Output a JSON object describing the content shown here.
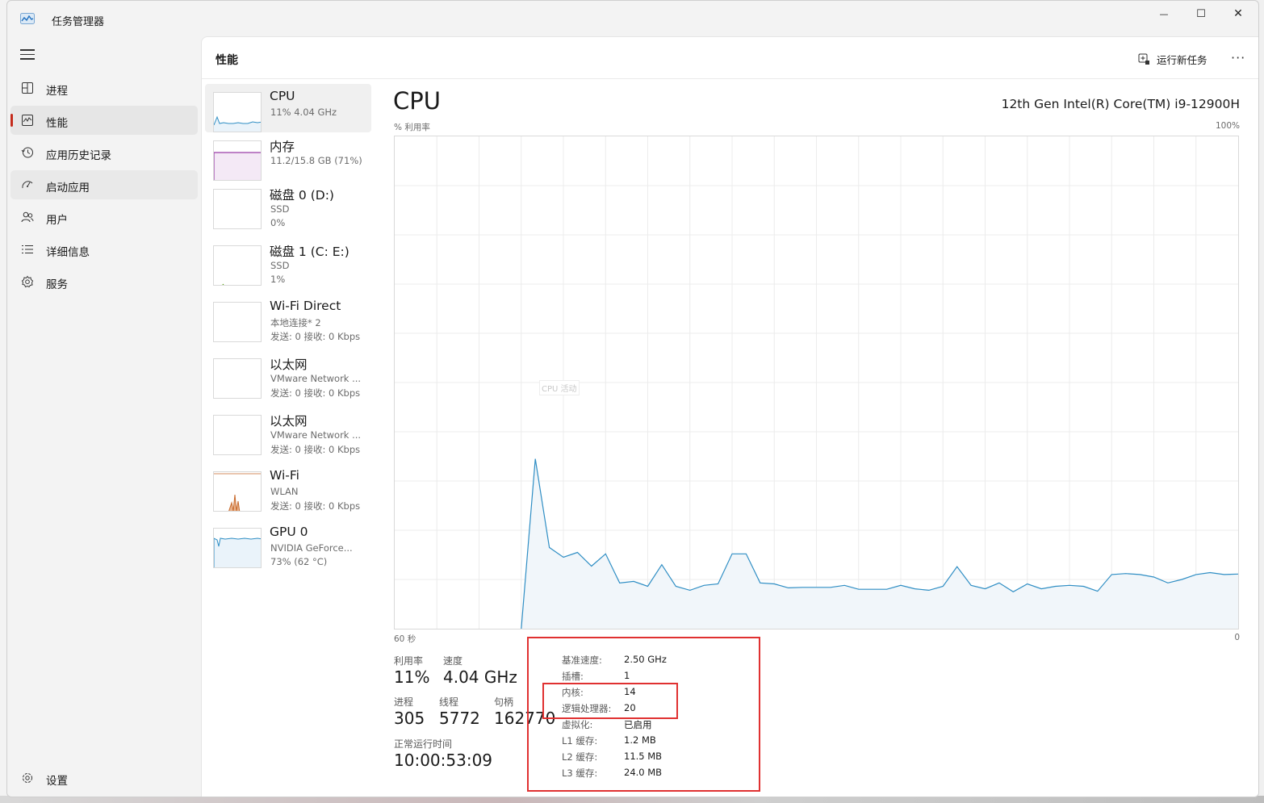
{
  "app": {
    "title": "任务管理器"
  },
  "window_controls": {
    "minimize": "—",
    "maximize": "☐",
    "close": "✕"
  },
  "sidebar": {
    "items": [
      {
        "label": "进程",
        "icon": "processes-icon"
      },
      {
        "label": "性能",
        "icon": "performance-icon",
        "selected": true
      },
      {
        "label": "应用历史记录",
        "icon": "history-icon"
      },
      {
        "label": "启动应用",
        "icon": "startup-icon"
      },
      {
        "label": "用户",
        "icon": "users-icon"
      },
      {
        "label": "详细信息",
        "icon": "details-icon"
      },
      {
        "label": "服务",
        "icon": "services-icon"
      }
    ],
    "settings_label": "设置"
  },
  "header": {
    "title": "性能",
    "run_task": "运行新任务",
    "more": "···"
  },
  "devices": [
    {
      "name": "CPU",
      "line2": "11% 4.04 GHz",
      "line3": ""
    },
    {
      "name": "内存",
      "line2": "11.2/15.8 GB (71%)",
      "line3": ""
    },
    {
      "name": "磁盘 0 (D:)",
      "line2": "SSD",
      "line3": "0%"
    },
    {
      "name": "磁盘 1 (C: E:)",
      "line2": "SSD",
      "line3": "1%"
    },
    {
      "name": "Wi-Fi Direct",
      "line2": "本地连接* 2",
      "line3": "发送: 0 接收: 0 Kbps"
    },
    {
      "name": "以太网",
      "line2": "VMware Network ...",
      "line3": "发送: 0 接收: 0 Kbps"
    },
    {
      "name": "以太网",
      "line2": "VMware Network ...",
      "line3": "发送: 0 接收: 0 Kbps"
    },
    {
      "name": "Wi-Fi",
      "line2": "WLAN",
      "line3": "发送: 0 接收: 0 Kbps"
    },
    {
      "name": "GPU 0",
      "line2": "NVIDIA GeForce...",
      "line3": "73% (62 °C)"
    }
  ],
  "main": {
    "title": "CPU",
    "model": "12th Gen Intel(R) Core(TM) i9-12900H",
    "y_label": "% 利用率",
    "y_max_label": "100%",
    "x_left_label": "60 秒",
    "x_right_label": "0",
    "activity_label": "CPU 活动",
    "stats": {
      "util_label": "利用率",
      "util_value": "11%",
      "speed_label": "速度",
      "speed_value": "4.04 GHz",
      "proc_label": "进程",
      "proc_value": "305",
      "thread_label": "线程",
      "thread_value": "5772",
      "handle_label": "句柄",
      "handle_value": "162770",
      "uptime_label": "正常运行时间",
      "uptime_value": "10:00:53:09"
    },
    "specs": [
      {
        "key": "基准速度:",
        "value": "2.50 GHz"
      },
      {
        "key": "插槽:",
        "value": "1"
      },
      {
        "key": "内核:",
        "value": "14"
      },
      {
        "key": "逻辑处理器:",
        "value": "20"
      },
      {
        "key": "虚拟化:",
        "value": "已启用"
      },
      {
        "key": "L1 缓存:",
        "value": "1.2 MB"
      },
      {
        "key": "L2 缓存:",
        "value": "11.5 MB"
      },
      {
        "key": "L3 缓存:",
        "value": "24.0 MB"
      }
    ]
  },
  "chart_data": {
    "type": "area",
    "xlabel": "60 秒",
    "ylabel": "% 利用率",
    "ylim": [
      0,
      100
    ],
    "xlim": [
      60,
      0
    ],
    "grid": true,
    "series": [
      {
        "x": [
          51,
          50,
          49,
          48,
          47,
          46,
          45,
          44,
          43,
          42,
          41,
          40,
          39,
          38,
          37,
          36,
          35,
          34,
          33,
          32,
          31,
          30,
          29,
          28,
          27,
          26,
          25,
          24,
          23,
          22,
          21,
          20,
          19,
          18,
          17,
          16,
          15,
          14,
          13,
          12,
          11,
          10,
          9,
          8,
          7,
          6,
          5,
          4,
          3,
          2,
          1,
          0
        ],
        "values": [
          0,
          34.5,
          16.5,
          14.5,
          15.5,
          12.7,
          15.2,
          9.3,
          9.6,
          8.6,
          13,
          8.6,
          7.8,
          8.8,
          9.1,
          15.2,
          15.2,
          9.3,
          9.1,
          8.3,
          8.4,
          8.4,
          8.4,
          8.8,
          8,
          8,
          8,
          8.8,
          8.1,
          7.8,
          8.6,
          12.6,
          8.8,
          8.1,
          9.3,
          7.5,
          9.1,
          8.1,
          8.6,
          8.8,
          8.6,
          7.6,
          11,
          11.2,
          11,
          10.5,
          9.3,
          10,
          11,
          11.4,
          11,
          11.1
        ]
      }
    ]
  },
  "colors": {
    "accent_line": "#2f8ec4",
    "accent_fill": "#f1f6fa",
    "memory": "#9b3ea8",
    "wifi": "#c8692b",
    "highlight": "#e03131"
  }
}
